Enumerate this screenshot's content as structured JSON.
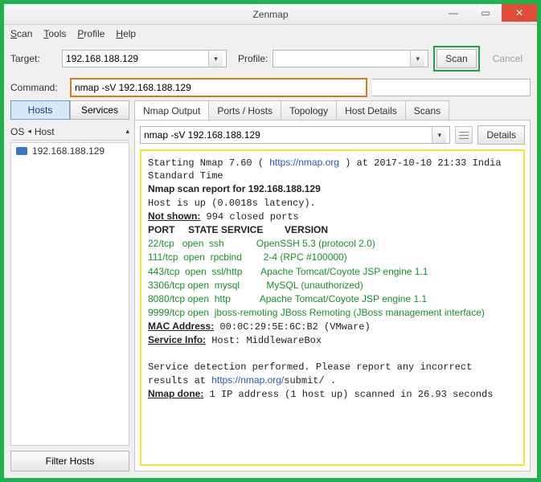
{
  "window": {
    "title": "Zenmap"
  },
  "menu": {
    "scan": "Scan",
    "tools": "Tools",
    "profile": "Profile",
    "help": "Help"
  },
  "target": {
    "label": "Target:",
    "value": "192.168.188.129"
  },
  "profile": {
    "label": "Profile:",
    "value": ""
  },
  "buttons": {
    "scan": "Scan",
    "cancel": "Cancel",
    "details": "Details",
    "filter": "Filter Hosts"
  },
  "command": {
    "label": "Command:",
    "value": "nmap -sV 192.168.188.129"
  },
  "left": {
    "hosts": "Hosts",
    "services": "Services",
    "os": "OS",
    "host_col": "Host",
    "host_entry": "192.168.188.129"
  },
  "tabs": {
    "output": "Nmap Output",
    "ports": "Ports / Hosts",
    "topology": "Topology",
    "hostdetails": "Host Details",
    "scans": "Scans"
  },
  "output_combo": "nmap -sV 192.168.188.129",
  "scan": {
    "start_a": "Starting Nmap 7.60 ( ",
    "start_url": "https://nmap.org",
    "start_b": " ) at 2017-10-10 21:33 India Standard Time",
    "report": "Nmap scan report for 192.168.188.129",
    "hostup": "Host is up (0.0018s latency).",
    "notshown_l": "Not shown:",
    "notshown_v": " 994 closed ports",
    "hdr_port": "PORT     STATE SERVICE        VERSION",
    "rows": [
      {
        "p": "22/tcp   open  ssh            ",
        "v": "OpenSSH 5.3 (protocol 2.0)"
      },
      {
        "p": "111/tcp  open  rpcbind        ",
        "v": "2-4 (RPC #100000)"
      },
      {
        "p": "443/tcp  open  ssl/http       ",
        "v": "Apache Tomcat/Coyote JSP engine 1.1"
      },
      {
        "p": "3306/tcp open  mysql          ",
        "v": "MySQL (unauthorized)"
      },
      {
        "p": "8080/tcp open  http           ",
        "v": "Apache Tomcat/Coyote JSP engine 1.1"
      },
      {
        "p": "9999/tcp open  jboss-remoting ",
        "v": "JBoss Remoting (JBoss management interface)"
      }
    ],
    "mac_l": "MAC Address:",
    "mac_v": " 00:0C:29:5E:6C:B2 (VMware)",
    "svc_l": "Service Info:",
    "svc_v": " Host: MiddlewareBox",
    "detect": "Service detection performed. Please report any incorrect results at ",
    "detect_url": "https://nmap.org/",
    "detect_tail": "submit/ .",
    "done_l": "Nmap done:",
    "done_v": " 1 IP address (1 host up) scanned in 26.93 seconds"
  }
}
